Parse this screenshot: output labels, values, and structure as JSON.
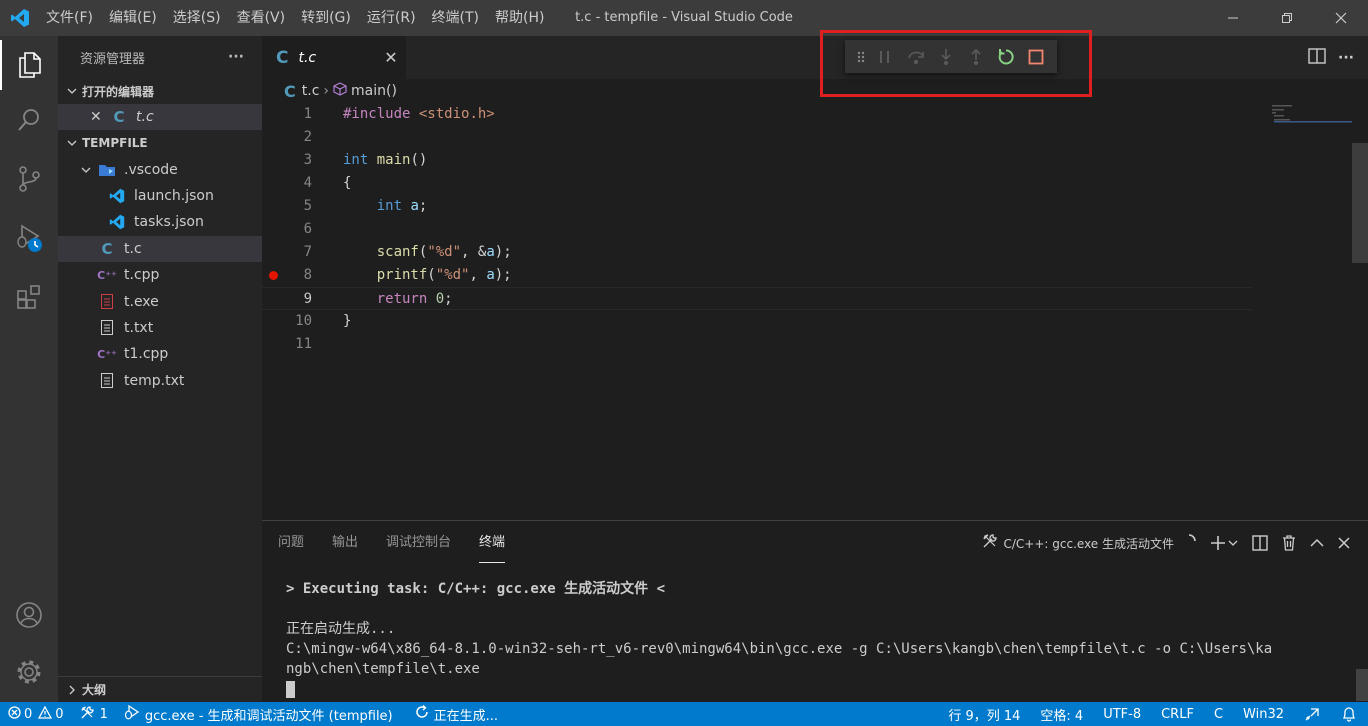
{
  "window": {
    "title": "t.c - tempfile - Visual Studio Code",
    "menu": [
      "文件(F)",
      "编辑(E)",
      "选择(S)",
      "查看(V)",
      "转到(G)",
      "运行(R)",
      "终端(T)",
      "帮助(H)"
    ],
    "controls": [
      "minimize-icon",
      "restore-icon",
      "close-icon"
    ]
  },
  "activity_bar": {
    "items": [
      "explorer-icon",
      "search-icon",
      "source-control-icon",
      "run-debug-icon",
      "extensions-icon"
    ],
    "bottom": [
      "account-icon",
      "settings-gear-icon"
    ]
  },
  "sidebar": {
    "header": "资源管理器",
    "more": "···",
    "open_editors": {
      "title": "打开的编辑器",
      "items": [
        {
          "name": "t.c",
          "icon": "c-file-icon"
        }
      ]
    },
    "folder": {
      "title": "TEMPFILE",
      "vscode_folder": ".vscode",
      "vscode_children": [
        "launch.json",
        "tasks.json"
      ],
      "files": [
        {
          "name": "t.c",
          "icon": "c-file-icon",
          "glyph": "C"
        },
        {
          "name": "t.cpp",
          "icon": "cpp-file-icon",
          "glyph": "C⁺⁺"
        },
        {
          "name": "t.exe",
          "icon": "exe-file-icon",
          "glyph": "▤"
        },
        {
          "name": "t.txt",
          "icon": "text-file-icon",
          "glyph": "≡"
        },
        {
          "name": "t1.cpp",
          "icon": "cpp-file-icon",
          "glyph": "C⁺⁺"
        },
        {
          "name": "temp.txt",
          "icon": "text-file-icon",
          "glyph": "≡"
        }
      ]
    },
    "outline": "大纲"
  },
  "editor": {
    "tab": {
      "label": "t.c",
      "close": "✕"
    },
    "breadcrumb": {
      "file": "t.c",
      "symbol": "main()"
    },
    "debug_toolbar": [
      "drag-handle-icon",
      "pause-icon",
      "step-over-icon",
      "step-into-icon",
      "step-out-icon",
      "restart-icon",
      "stop-icon"
    ],
    "current_line": 9,
    "breakpoint_line": 8,
    "lines": [
      {
        "n": "1",
        "tokens": [
          {
            "t": "#include",
            "c": "kw-pp"
          },
          {
            "t": " ",
            "c": ""
          },
          {
            "t": "<stdio.h>",
            "c": "kw-inc"
          }
        ]
      },
      {
        "n": "2",
        "tokens": []
      },
      {
        "n": "3",
        "tokens": [
          {
            "t": "int",
            "c": "kw-type"
          },
          {
            "t": " ",
            "c": ""
          },
          {
            "t": "main",
            "c": "kw-fn"
          },
          {
            "t": "()",
            "c": ""
          }
        ]
      },
      {
        "n": "4",
        "tokens": [
          {
            "t": "{",
            "c": ""
          }
        ]
      },
      {
        "n": "5",
        "tokens": [
          {
            "t": "    ",
            "c": ""
          },
          {
            "t": "int",
            "c": "kw-type"
          },
          {
            "t": " ",
            "c": ""
          },
          {
            "t": "a",
            "c": "kw-var"
          },
          {
            "t": ";",
            "c": ""
          }
        ]
      },
      {
        "n": "6",
        "tokens": []
      },
      {
        "n": "7",
        "tokens": [
          {
            "t": "    ",
            "c": ""
          },
          {
            "t": "scanf",
            "c": "kw-fn"
          },
          {
            "t": "(",
            "c": ""
          },
          {
            "t": "\"%d\"",
            "c": "kw-str"
          },
          {
            "t": ", &",
            "c": ""
          },
          {
            "t": "a",
            "c": "kw-var"
          },
          {
            "t": ");",
            "c": ""
          }
        ]
      },
      {
        "n": "8",
        "tokens": [
          {
            "t": "    ",
            "c": ""
          },
          {
            "t": "printf",
            "c": "kw-fn"
          },
          {
            "t": "(",
            "c": ""
          },
          {
            "t": "\"%d\"",
            "c": "kw-str"
          },
          {
            "t": ", ",
            "c": ""
          },
          {
            "t": "a",
            "c": "kw-var"
          },
          {
            "t": ");",
            "c": ""
          }
        ]
      },
      {
        "n": "9",
        "tokens": [
          {
            "t": "    ",
            "c": ""
          },
          {
            "t": "return",
            "c": "kw-ctrl"
          },
          {
            "t": " ",
            "c": ""
          },
          {
            "t": "0",
            "c": "kw-num"
          },
          {
            "t": ";",
            "c": ""
          }
        ]
      },
      {
        "n": "10",
        "tokens": [
          {
            "t": "}",
            "c": ""
          }
        ]
      },
      {
        "n": "11",
        "tokens": []
      }
    ]
  },
  "panel": {
    "tabs": [
      "问题",
      "输出",
      "调试控制台",
      "终端"
    ],
    "active_tab": "终端",
    "terminal_name": "C/C++: gcc.exe 生成活动文件",
    "terminal": {
      "exec_line": "> Executing task: C/C++: gcc.exe 生成活动文件 <",
      "line1": "正在启动生成...",
      "line2": "C:\\mingw-w64\\x86_64-8.1.0-win32-seh-rt_v6-rev0\\mingw64\\bin\\gcc.exe -g C:\\Users\\kangb\\chen\\tempfile\\t.c -o C:\\Users\\ka",
      "line3": "ngb\\chen\\tempfile\\t.exe"
    }
  },
  "status_bar": {
    "errors": "0",
    "warnings": "0",
    "tools": "1",
    "debug_config": "gcc.exe - 生成和调试活动文件 (tempfile)",
    "building": "正在生成...",
    "position": "行 9，列 14",
    "spaces": "空格: 4",
    "encoding": "UTF-8",
    "eol": "CRLF",
    "language": "C",
    "platform": "Win32"
  },
  "colors": {
    "status_bar": "#007acc",
    "breakpoint": "#e51400",
    "restart": "#89d185",
    "stop": "#f48771",
    "highlight_box": "#e02020"
  }
}
